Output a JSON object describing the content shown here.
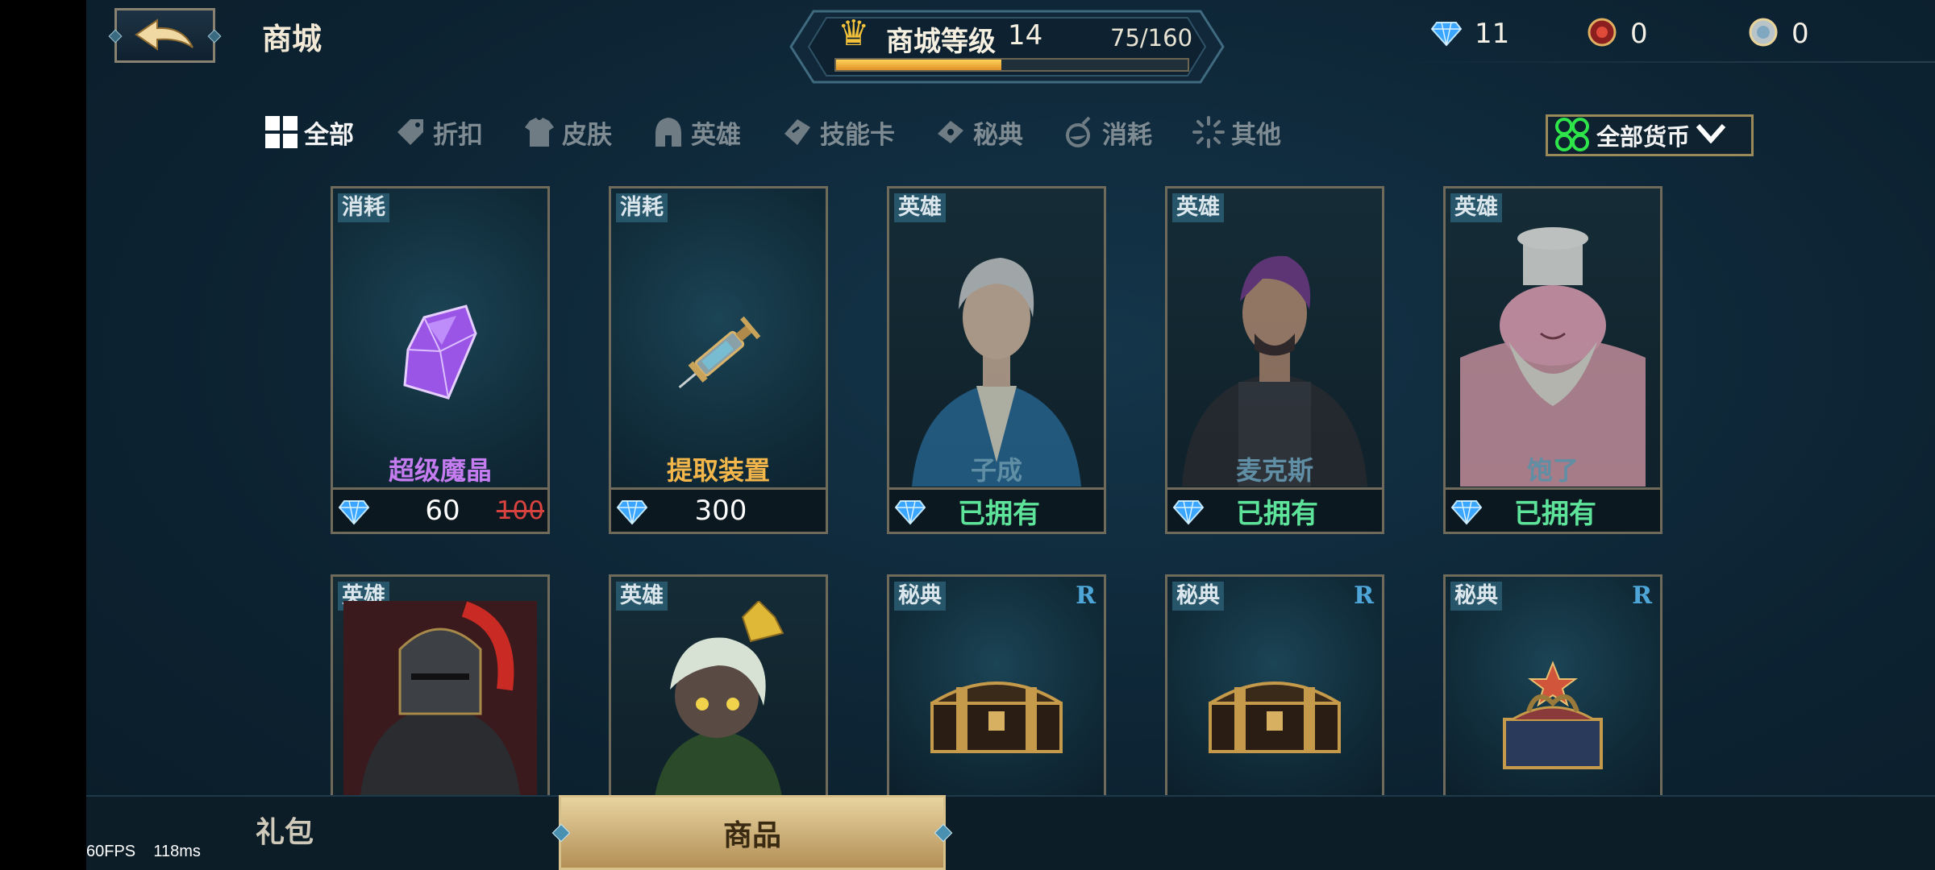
{
  "header": {
    "title": "商城",
    "level_label": "商城等级",
    "level": "14",
    "xp_text": "75/160",
    "xp_progress": 0.47
  },
  "currencies": [
    {
      "icon": "diamond-icon",
      "value": "11"
    },
    {
      "icon": "red-token-icon",
      "value": "0"
    },
    {
      "icon": "silver-coin-icon",
      "value": "0"
    }
  ],
  "tabs": [
    {
      "label": "全部",
      "icon": "grid-icon",
      "active": true
    },
    {
      "label": "折扣",
      "icon": "price-tag-icon"
    },
    {
      "label": "皮肤",
      "icon": "armor-icon"
    },
    {
      "label": "英雄",
      "icon": "helmet-icon"
    },
    {
      "label": "技能卡",
      "icon": "skill-card-icon"
    },
    {
      "label": "秘典",
      "icon": "tome-icon"
    },
    {
      "label": "消耗",
      "icon": "potion-icon"
    },
    {
      "label": "其他",
      "icon": "sparkle-icon"
    }
  ],
  "currency_filter": "全部货币",
  "items_row1": [
    {
      "tag": "消耗",
      "name": "超级魔晶",
      "price": "60",
      "old_price": "100",
      "name_color": "#c47cf0"
    },
    {
      "tag": "消耗",
      "name": "提取装置",
      "price": "300",
      "name_color": "#f2b64a"
    },
    {
      "tag": "英雄",
      "name": "子成",
      "owned": "已拥有",
      "name_color": "#5f8ea5"
    },
    {
      "tag": "英雄",
      "name": "麦克斯",
      "owned": "已拥有",
      "name_color": "#5f8ea5"
    },
    {
      "tag": "英雄",
      "name": "饱了",
      "owned": "已拥有",
      "name_color": "#5f8ea5"
    }
  ],
  "items_row2": [
    {
      "tag": "英雄"
    },
    {
      "tag": "英雄"
    },
    {
      "tag": "秘典",
      "rarity": "R"
    },
    {
      "tag": "秘典",
      "rarity": "R"
    },
    {
      "tag": "秘典",
      "rarity": "R"
    }
  ],
  "bottom_nav": {
    "gift": "礼包",
    "goods": "商品"
  },
  "debug": {
    "fps": "60FPS",
    "latency": "118ms"
  }
}
